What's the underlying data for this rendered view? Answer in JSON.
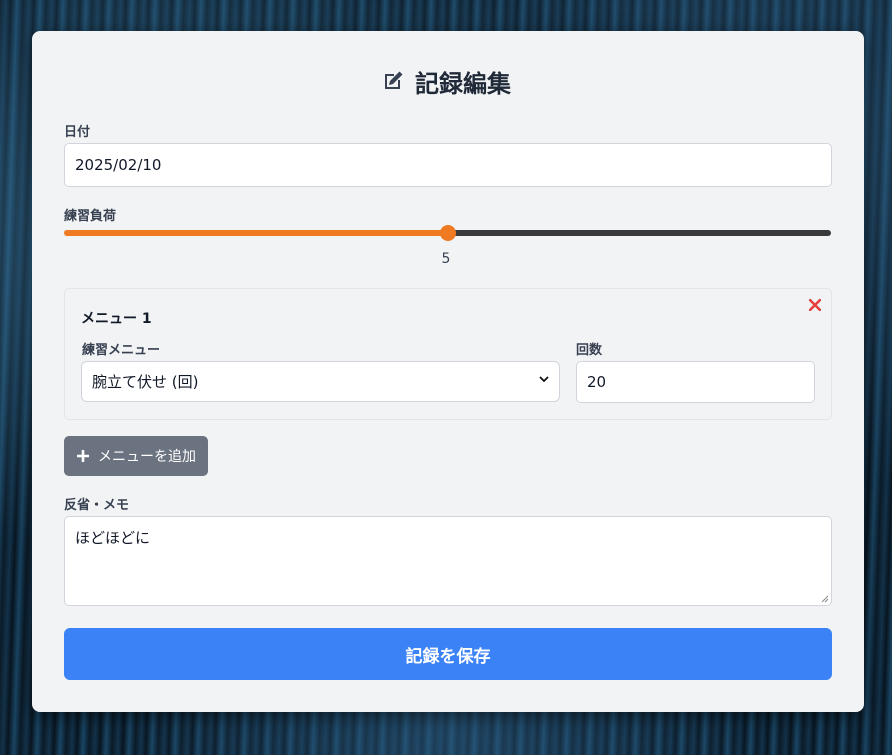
{
  "header": {
    "title": "記録編集",
    "icon": "edit-icon"
  },
  "date": {
    "label": "日付",
    "value": "2025/02/10"
  },
  "load": {
    "label": "練習負荷",
    "value": "5",
    "level_fraction": 0.5
  },
  "menus": [
    {
      "title": "メニュー 1",
      "exercise_label": "練習メニュー",
      "exercise_value": "腕立て伏せ (回)",
      "count_label": "回数",
      "count_value": "20"
    }
  ],
  "add_menu": {
    "label": "メニューを追加",
    "icon": "plus-icon"
  },
  "memo": {
    "label": "反省・メモ",
    "value": "ほどほどに"
  },
  "save": {
    "label": "記録を保存"
  },
  "colors": {
    "accent": "#f07a22",
    "primary": "#3b82f6",
    "danger": "#e53e3e",
    "secondary": "#6b7280"
  }
}
